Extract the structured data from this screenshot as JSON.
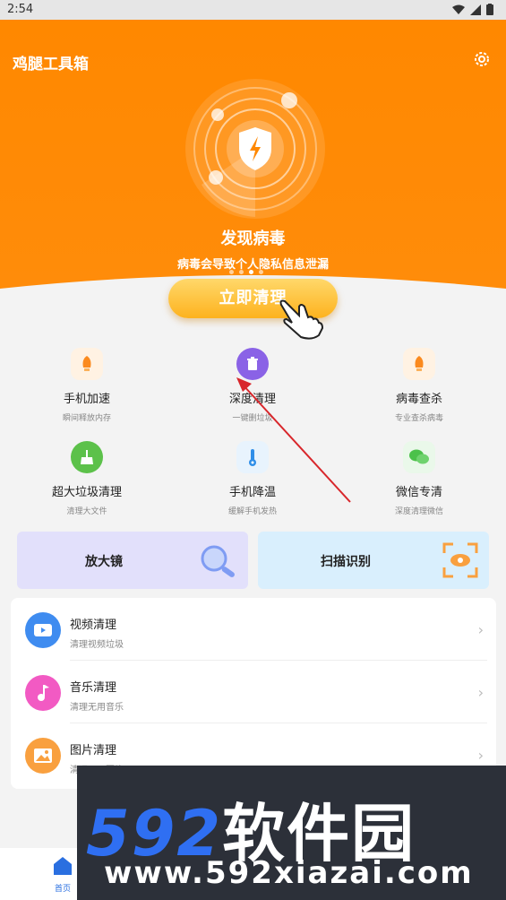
{
  "status_bar": {
    "time": "2:54"
  },
  "header": {
    "title": "鸡腿工具箱"
  },
  "hero": {
    "title": "发现病毒",
    "subtitle": "病毒会导致个人隐私信息泄漏",
    "clean_button": "立即清理",
    "page_dots": 4,
    "active_dot": 3
  },
  "tools": [
    {
      "name": "手机加速",
      "desc": "瞬间释放内存",
      "icon": "rocket-icon",
      "color": "#fb8a1e"
    },
    {
      "name": "深度清理",
      "desc": "一键删垃圾",
      "icon": "trash-icon",
      "color": "#8a62e6"
    },
    {
      "name": "病毒查杀",
      "desc": "专业查杀病毒",
      "icon": "rocket-icon",
      "color": "#fb8a1e"
    },
    {
      "name": "超大垃圾清理",
      "desc": "清理大文件",
      "icon": "broom-icon",
      "color": "#5cc14a"
    },
    {
      "name": "手机降温",
      "desc": "缓解手机发热",
      "icon": "thermometer-icon",
      "color": "#2f8ee8"
    },
    {
      "name": "微信专清",
      "desc": "深度清理微信",
      "icon": "wechat-icon",
      "color": "#4cc14b"
    }
  ],
  "cards": [
    {
      "label": "放大镜",
      "icon": "magnifier-icon",
      "color": "#e2e0fb"
    },
    {
      "label": "扫描识别",
      "icon": "scan-icon",
      "color": "#d9effd"
    }
  ],
  "list": [
    {
      "title": "视频清理",
      "sub": "清理视频垃圾",
      "icon": "video-icon",
      "color": "#3f8cf0"
    },
    {
      "title": "音乐清理",
      "sub": "清理无用音乐",
      "icon": "music-icon",
      "color": "#f25ac3"
    },
    {
      "title": "图片清理",
      "sub": "清理无用图片",
      "icon": "image-icon",
      "color": "#f9a03f"
    }
  ],
  "bottom_nav": {
    "home": "首页"
  },
  "watermark": {
    "line1_num": "592",
    "line1_cn": "软件园",
    "line2": "www.592xiazai.com"
  },
  "colors": {
    "accent": "#ff8a00",
    "button": "#fdb21e"
  }
}
